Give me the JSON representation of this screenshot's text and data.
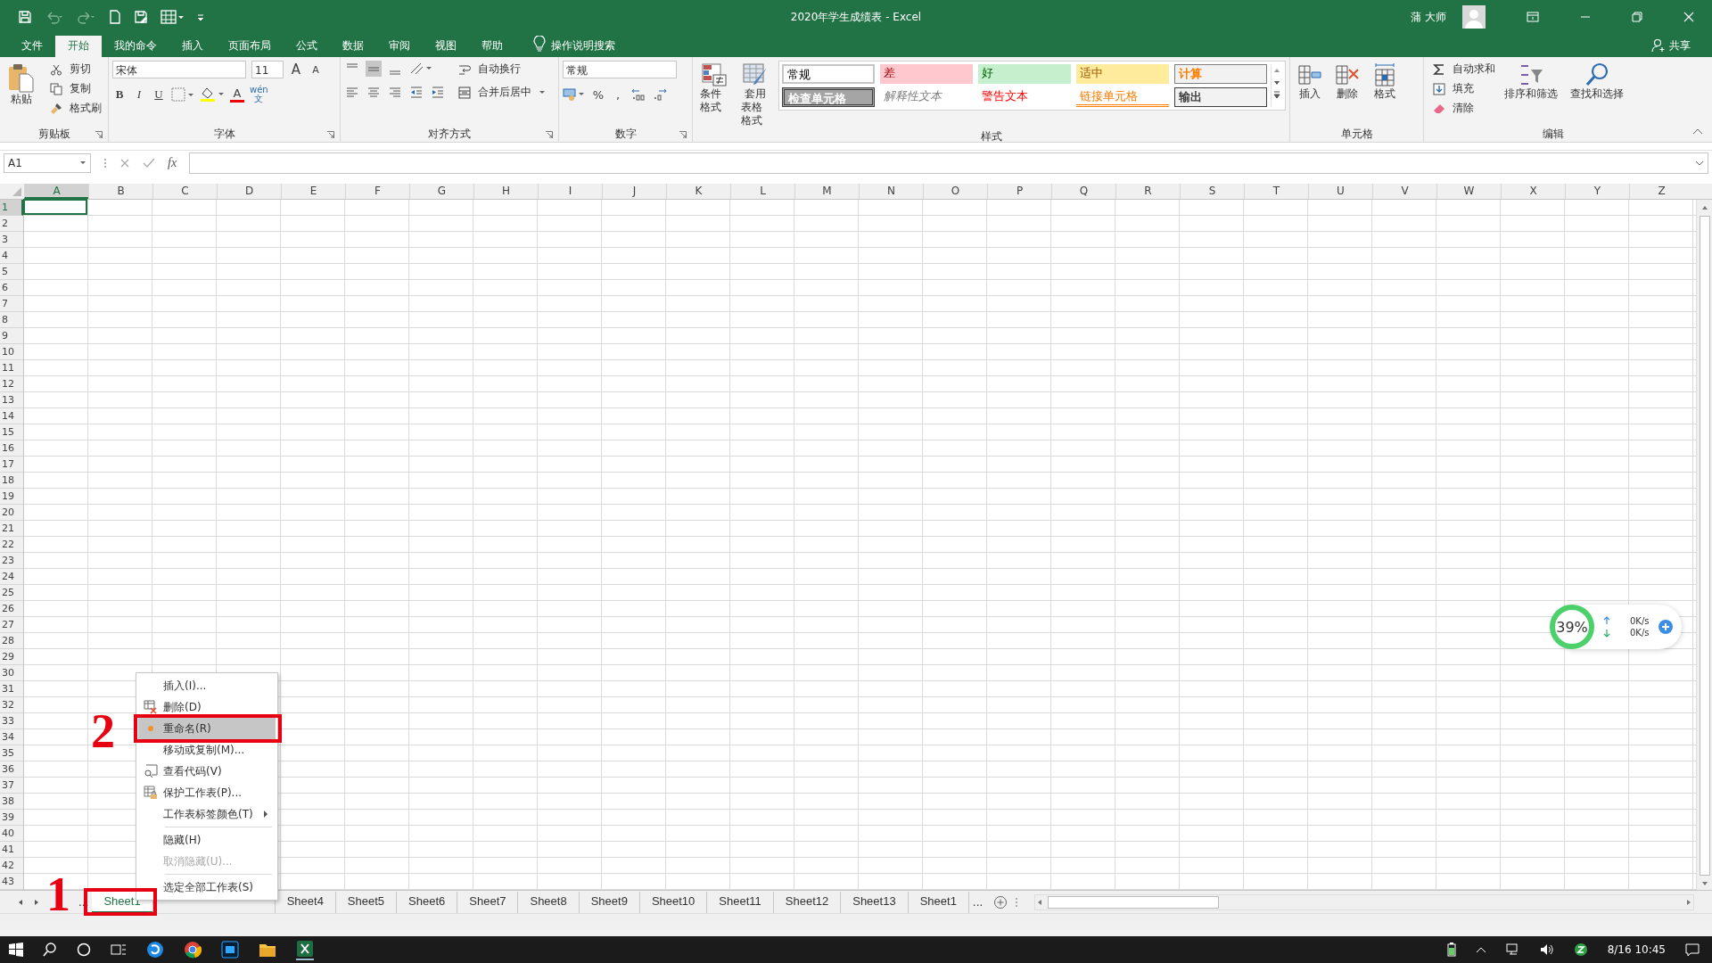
{
  "window": {
    "title": "2020年学生成绩表 - Excel",
    "user": "蒲 大师"
  },
  "tabs": [
    {
      "label": "文件",
      "selected": false
    },
    {
      "label": "开始",
      "selected": true
    },
    {
      "label": "我的命令",
      "selected": false
    },
    {
      "label": "插入",
      "selected": false
    },
    {
      "label": "页面布局",
      "selected": false
    },
    {
      "label": "公式",
      "selected": false
    },
    {
      "label": "数据",
      "selected": false
    },
    {
      "label": "审阅",
      "selected": false
    },
    {
      "label": "视图",
      "selected": false
    },
    {
      "label": "帮助",
      "selected": false
    }
  ],
  "tell_me": "操作说明搜索",
  "share": "共享",
  "ribbon": {
    "clipboard": {
      "label": "剪贴板",
      "paste": "粘贴",
      "cut": "剪切",
      "copy": "复制",
      "format_painter": "格式刷"
    },
    "font": {
      "label": "字体",
      "font_name": "宋体",
      "font_size": "11",
      "grow": "A",
      "shrink": "A",
      "bold": "B",
      "italic": "I",
      "underline": "U",
      "font_color": "A",
      "phonetic_top": "wén",
      "phonetic_bottom": "文"
    },
    "alignment": {
      "label": "对齐方式",
      "wrap_text": "自动换行",
      "merge_center": "合并后居中"
    },
    "number": {
      "label": "数字",
      "format": "常规",
      "percent": "%",
      "comma": ","
    },
    "styles": {
      "label": "样式",
      "conditional": "条件格式",
      "table_top": "套用",
      "table_bottom": "表格格式",
      "gallery": [
        {
          "label": "常规",
          "kind": "normal"
        },
        {
          "label": "差",
          "kind": "bad"
        },
        {
          "label": "好",
          "kind": "good"
        },
        {
          "label": "适中",
          "kind": "neutral"
        },
        {
          "label": "计算",
          "kind": "calculation"
        },
        {
          "label": "检查单元格",
          "kind": "check"
        },
        {
          "label": "解释性文本",
          "kind": "explanatory"
        },
        {
          "label": "警告文本",
          "kind": "warning"
        },
        {
          "label": "链接单元格",
          "kind": "linked"
        },
        {
          "label": "输出",
          "kind": "output"
        }
      ]
    },
    "cells": {
      "label": "单元格",
      "insert": "插入",
      "delete": "删除",
      "format": "格式"
    },
    "editing": {
      "label": "编辑",
      "autosum": "自动求和",
      "fill": "填充",
      "clear": "清除",
      "sort_filter": "排序和筛选",
      "find_select": "查找和选择"
    }
  },
  "formula_bar": {
    "name_box": "A1",
    "fx": "fx"
  },
  "columns": [
    "A",
    "B",
    "C",
    "D",
    "E",
    "F",
    "G",
    "H",
    "I",
    "J",
    "K",
    "L",
    "M",
    "N",
    "O",
    "P",
    "Q",
    "R",
    "S",
    "T",
    "U",
    "V",
    "W",
    "X",
    "Y",
    "Z"
  ],
  "rows": [
    "1",
    "2",
    "3",
    "4",
    "5",
    "6",
    "7",
    "8",
    "9",
    "10",
    "11",
    "12",
    "13",
    "14",
    "15",
    "16",
    "17",
    "18",
    "19",
    "20",
    "21",
    "22",
    "23",
    "24",
    "25",
    "26",
    "27",
    "28",
    "29",
    "30",
    "31",
    "32",
    "33",
    "34",
    "35",
    "36",
    "37",
    "38",
    "39",
    "40",
    "41",
    "42",
    "43"
  ],
  "sheets_more_left": "...",
  "sheets": [
    {
      "label": "Sheet1",
      "selected": true
    },
    {
      "label": "Sheet4",
      "selected": false
    },
    {
      "label": "Sheet5",
      "selected": false
    },
    {
      "label": "Sheet6",
      "selected": false
    },
    {
      "label": "Sheet7",
      "selected": false
    },
    {
      "label": "Sheet8",
      "selected": false
    },
    {
      "label": "Sheet9",
      "selected": false
    },
    {
      "label": "Sheet10",
      "selected": false
    },
    {
      "label": "Sheet11",
      "selected": false
    },
    {
      "label": "Sheet12",
      "selected": false
    },
    {
      "label": "Sheet13",
      "selected": false
    },
    {
      "label": "Sheet1",
      "selected": false
    }
  ],
  "sheets_more_right": "...",
  "context_menu": [
    {
      "label": "插入(I)...",
      "kind": "plain",
      "selected": false,
      "disabled": false,
      "submenu": false,
      "separator_before": false
    },
    {
      "label": "删除(D)",
      "kind": "delete",
      "selected": false,
      "disabled": false,
      "submenu": false,
      "separator_before": false
    },
    {
      "label": "重命名(R)",
      "kind": "plain",
      "selected": true,
      "disabled": false,
      "submenu": false,
      "separator_before": false
    },
    {
      "label": "移动或复制(M)...",
      "kind": "plain",
      "selected": false,
      "disabled": false,
      "submenu": false,
      "separator_before": false
    },
    {
      "label": "查看代码(V)",
      "kind": "code",
      "selected": false,
      "disabled": false,
      "submenu": false,
      "separator_before": false
    },
    {
      "label": "保护工作表(P)...",
      "kind": "protect",
      "selected": false,
      "disabled": false,
      "submenu": false,
      "separator_before": false
    },
    {
      "label": "工作表标签颜色(T)",
      "kind": "plain",
      "selected": false,
      "disabled": false,
      "submenu": true,
      "separator_before": false
    },
    {
      "label": "隐藏(H)",
      "kind": "plain",
      "selected": false,
      "disabled": false,
      "submenu": false,
      "separator_before": true
    },
    {
      "label": "取消隐藏(U)...",
      "kind": "plain",
      "selected": false,
      "disabled": true,
      "submenu": false,
      "separator_before": false
    },
    {
      "label": "选定全部工作表(S)",
      "kind": "plain",
      "selected": false,
      "disabled": false,
      "submenu": false,
      "separator_before": true
    }
  ],
  "annotations": [
    {
      "label": "1"
    },
    {
      "label": "2"
    }
  ],
  "speed_widget": {
    "percent": "39%",
    "upload": "0K/s",
    "download": "0K/s"
  },
  "taskbar": {
    "clock": "8/16 10:45"
  }
}
